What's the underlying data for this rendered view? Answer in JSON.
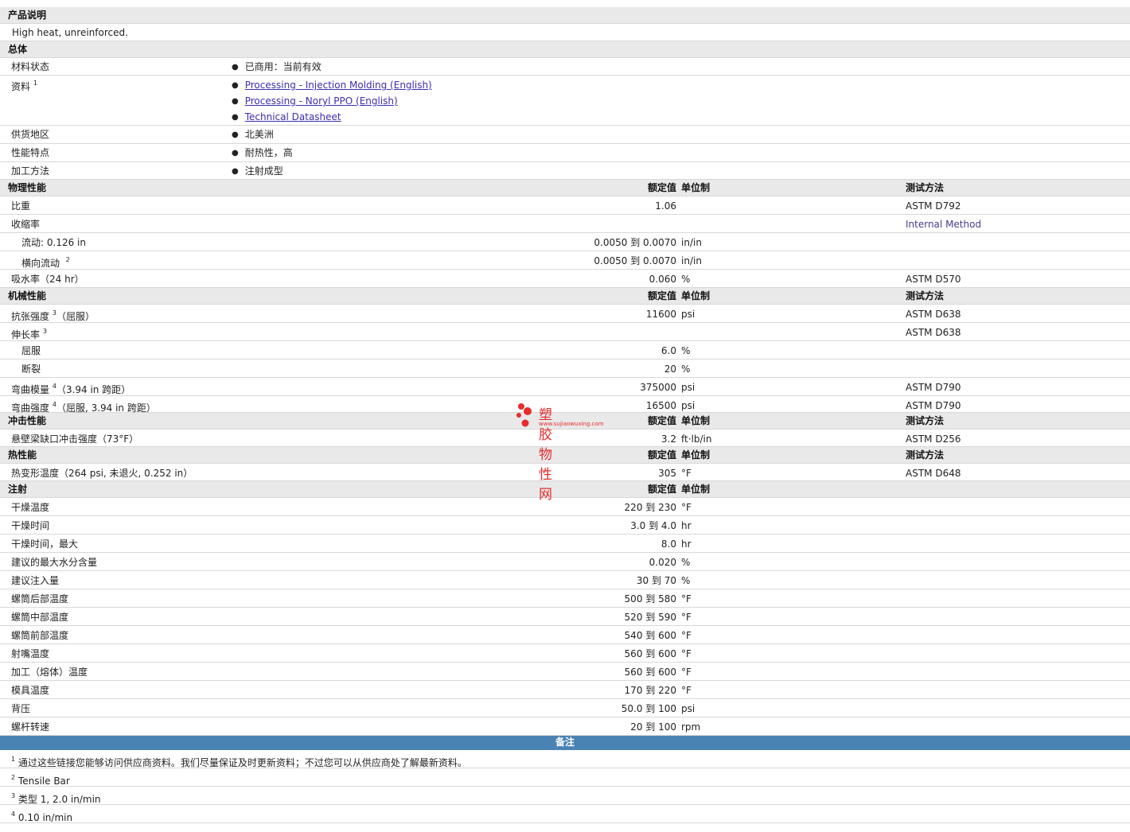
{
  "desc": {
    "title": "产品说明",
    "text": "High heat, unreinforced."
  },
  "general": {
    "title": "总体",
    "status_label": "材料状态",
    "status_value": "已商用：当前有效",
    "docs_label": "资料",
    "docs_sup": "1",
    "docs": [
      "Processing - Injection Molding (English)",
      "Processing - Noryl PPO (English)",
      "Technical Datasheet"
    ],
    "region_label": "供货地区",
    "region_value": "北美洲",
    "feature_label": "性能特点",
    "feature_value": "耐热性，高",
    "method_label": "加工方法",
    "method_value": "注射成型"
  },
  "headers": {
    "rated": "额定值",
    "unit": "单位制",
    "test": "测试方法"
  },
  "physical": {
    "title": "物理性能",
    "sg_label": "比重",
    "sg_value": "1.06",
    "sg_test": "ASTM D792",
    "shrink_label": "收缩率",
    "shrink_test": "Internal Method",
    "flow_label": "流动: 0.126 in",
    "flow_value": "0.0050 到  0.0070",
    "flow_unit": "in/in",
    "trans_label": "横向流动",
    "trans_sup": "2",
    "trans_value": "0.0050 到  0.0070",
    "trans_unit": "in/in",
    "water_label": "吸水率（24 hr）",
    "water_value": "0.060",
    "water_unit": "%",
    "water_test": "ASTM D570"
  },
  "mechanical": {
    "title": "机械性能",
    "tensile_label": "抗张强度",
    "tensile_sup": "3",
    "tensile_suffix": "（屈服）",
    "tensile_value": "11600",
    "tensile_unit": "psi",
    "tensile_test": "ASTM D638",
    "elong_label": "伸长率",
    "elong_sup": "3",
    "elong_test": "ASTM D638",
    "yield_label": "屈服",
    "yield_value": "6.0",
    "yield_unit": "%",
    "break_label": "断裂",
    "break_value": "20",
    "break_unit": "%",
    "flexmod_label": "弯曲模量",
    "flexmod_sup": "4",
    "flexmod_suffix": "（3.94 in 跨距）",
    "flexmod_value": "375000",
    "flexmod_unit": "psi",
    "flexmod_test": "ASTM D790",
    "flexstr_label": "弯曲强度",
    "flexstr_sup": "4",
    "flexstr_suffix": "（屈服, 3.94 in 跨距）",
    "flexstr_value": "16500",
    "flexstr_unit": "psi",
    "flexstr_test": "ASTM D790"
  },
  "impact": {
    "title": "冲击性能",
    "izod_label": "悬壁梁缺口冲击强度（73°F）",
    "izod_value": "3.2",
    "izod_unit": "ft·lb/in",
    "izod_test": "ASTM D256"
  },
  "thermal": {
    "title": "热性能",
    "hdt_label": "热变形温度（264 psi, 未退火, 0.252 in）",
    "hdt_value": "305",
    "hdt_unit": "°F",
    "hdt_test": "ASTM D648"
  },
  "injection": {
    "title": "注射",
    "rows": [
      {
        "label": "干燥温度",
        "value": "220 到  230",
        "unit": "°F"
      },
      {
        "label": "干燥时间",
        "value": "3.0 到  4.0",
        "unit": "hr"
      },
      {
        "label": "干燥时间，最大",
        "value": "8.0",
        "unit": "hr"
      },
      {
        "label": "建议的最大水分含量",
        "value": "0.020",
        "unit": "%"
      },
      {
        "label": "建议注入量",
        "value": "30 到  70",
        "unit": "%"
      },
      {
        "label": "螺筒后部温度",
        "value": "500 到  580",
        "unit": "°F"
      },
      {
        "label": "螺筒中部温度",
        "value": "520 到  590",
        "unit": "°F"
      },
      {
        "label": "螺筒前部温度",
        "value": "540 到  600",
        "unit": "°F"
      },
      {
        "label": "射嘴温度",
        "value": "560 到  600",
        "unit": "°F"
      },
      {
        "label": "加工（熔体）温度",
        "value": "560 到  600",
        "unit": "°F"
      },
      {
        "label": "模具温度",
        "value": "170 到  220",
        "unit": "°F"
      },
      {
        "label": "背压",
        "value": "50.0 到  100",
        "unit": "psi"
      },
      {
        "label": "螺杆转速",
        "value": "20 到  100",
        "unit": "rpm"
      }
    ]
  },
  "notes": {
    "title": "备注",
    "items": [
      {
        "sup": "1",
        "text": "通过这些链接您能够访问供应商资料。我们尽量保证及时更新资料；不过您可以从供应商处了解最新资料。"
      },
      {
        "sup": "2",
        "text": "Tensile Bar"
      },
      {
        "sup": "3",
        "text": "类型  1, 2.0 in/min"
      },
      {
        "sup": "4",
        "text": "0.10 in/min"
      }
    ]
  },
  "logo": {
    "name": "塑胶物性网",
    "url": "www.sujiaowuxing.com"
  }
}
